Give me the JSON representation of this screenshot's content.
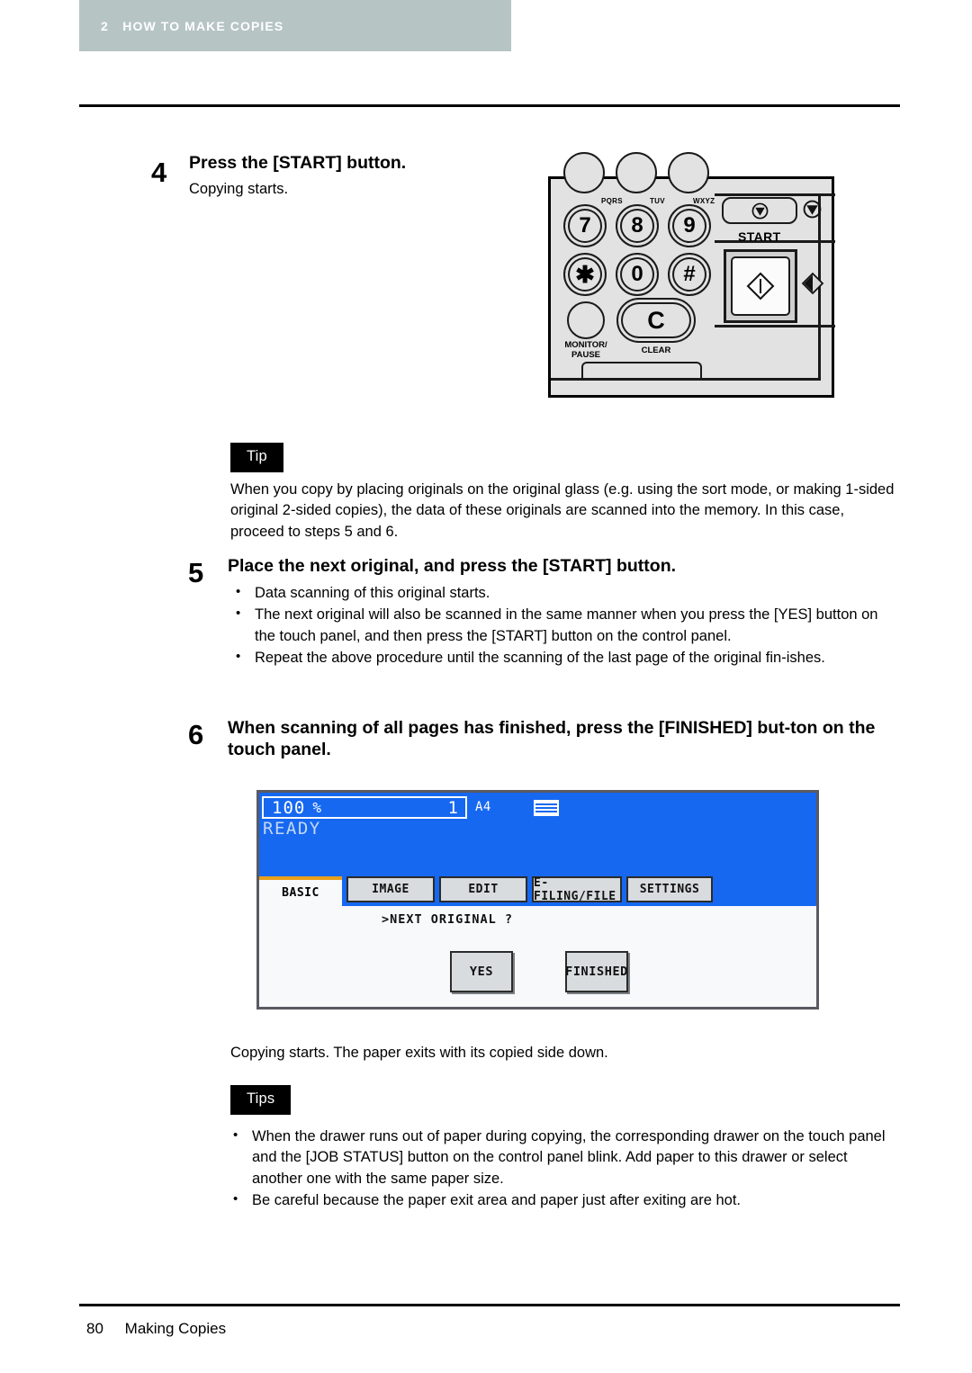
{
  "header": {
    "chapter_number": "2",
    "chapter_title": "HOW TO MAKE COPIES",
    "banner_color": "#b6c4c4"
  },
  "steps": [
    {
      "number": "4",
      "title": "Press the [START] button.",
      "subtext": "Copying starts."
    },
    {
      "number": "5",
      "title": "Place the next original, and press the [START] button.",
      "bullets": [
        "Data scanning of this original starts.",
        "The next original will also be scanned in the same manner when you press the [YES] button on the touch panel, and then press the [START] button on the control panel.",
        "Repeat the above procedure until the scanning of the last page of the original fin-ishes."
      ]
    },
    {
      "number": "6",
      "title": "When scanning of all pages has finished, press the [FINISHED] but-ton on the touch panel."
    }
  ],
  "tip_box": {
    "label": "Tip",
    "text": "When you copy by placing originals on the original glass (e.g. using the sort mode, or making 1-sided original 2-sided copies), the data of these originals are scanned into the memory. In this case, proceed to steps 5 and 6."
  },
  "after_panel_text": "Copying starts. The paper exits with its copied side down.",
  "tips_box": {
    "label": "Tips",
    "bullets": [
      "When the drawer runs out of paper during copying, the corresponding drawer on the touch panel and the [JOB STATUS] button on the control panel blink. Add paper to this drawer or select another one with the same paper size.",
      "Be careful because the paper exit area and paper just after exiting are hot."
    ]
  },
  "control_panel": {
    "keys": [
      {
        "label": "7",
        "letters": "PQRS"
      },
      {
        "label": "8",
        "letters": "TUV"
      },
      {
        "label": "9",
        "letters": "WXYZ"
      },
      {
        "label": "✳",
        "letters": ""
      },
      {
        "label": "0",
        "letters": ""
      },
      {
        "label": "#",
        "letters": ""
      }
    ],
    "monitor_pause_caption": "MONITOR/\nPAUSE",
    "clear_key_label": "C",
    "clear_caption": "CLEAR",
    "start_label": "START"
  },
  "touch_panel": {
    "zoom_ratio": "100",
    "percent_symbol": "%",
    "copy_count": "1",
    "paper_size": "A4",
    "status": "READY",
    "tabs": [
      {
        "label": "BASIC",
        "active": true
      },
      {
        "label": "IMAGE",
        "active": false
      },
      {
        "label": "EDIT",
        "active": false
      },
      {
        "label": "E-FILING/FILE",
        "active": false
      },
      {
        "label": "SETTINGS",
        "active": false
      }
    ],
    "prompt": ">NEXT ORIGINAL ?",
    "buttons": [
      {
        "label": "YES"
      },
      {
        "label": "FINISHED"
      }
    ],
    "accent_color": "#1668f0",
    "tab_highlight_color": "#e8a01c"
  },
  "footer": {
    "page_number": "80",
    "section_title": "Making Copies"
  }
}
